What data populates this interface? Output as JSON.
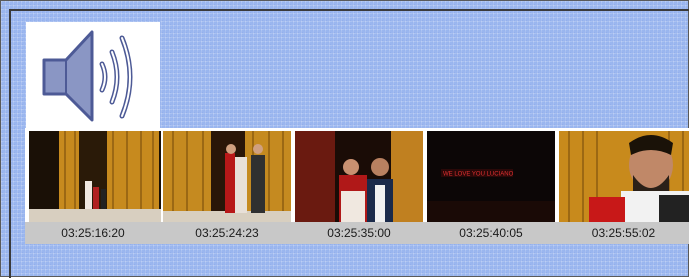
{
  "audio_clip": {
    "icon": "speaker-icon"
  },
  "thumbnails": [
    {
      "timecode": "03:25:16:20"
    },
    {
      "timecode": "03:25:24:23"
    },
    {
      "timecode": "03:25:35:00"
    },
    {
      "timecode": "03:25:40:05"
    },
    {
      "timecode": "03:25:55:02",
      "banner": "WE LOVE YOU LUCIANO"
    }
  ],
  "colors": {
    "panel_background": "#9ab6ef",
    "timecode_background": "#c8c8c8",
    "curtain_gold": "#d8a02a"
  }
}
